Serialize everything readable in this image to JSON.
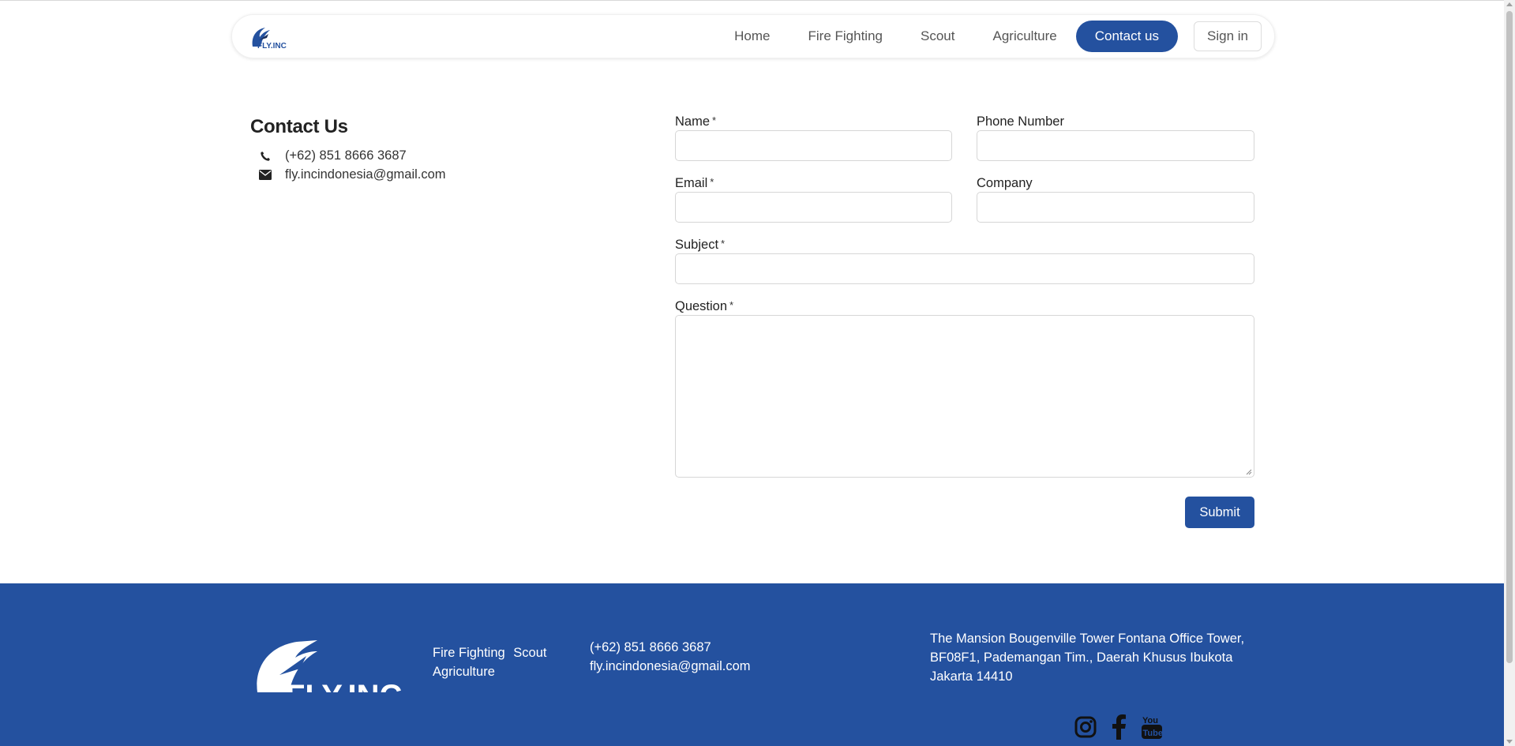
{
  "brand": {
    "logo_text": "FLY.INC",
    "primary_color": "#24519f"
  },
  "nav": {
    "items": [
      {
        "label": "Home"
      },
      {
        "label": "Fire Fighting"
      },
      {
        "label": "Scout"
      },
      {
        "label": "Agriculture"
      }
    ],
    "contact_label": "Contact us",
    "signin_label": "Sign in"
  },
  "contact": {
    "title": "Contact Us",
    "phone": "(+62) 851 8666 3687",
    "email": "fly.incindonesia@gmail.com",
    "phone_icon": "phone-icon",
    "email_icon": "envelope-icon"
  },
  "form": {
    "name_label": "Name",
    "phone_label": "Phone Number",
    "email_label": "Email",
    "company_label": "Company",
    "subject_label": "Subject",
    "question_label": "Question",
    "required_mark": "*",
    "name_value": "",
    "phone_value": "",
    "email_value": "",
    "company_value": "",
    "subject_value": "",
    "question_value": "",
    "submit_label": "Submit"
  },
  "footer": {
    "logo_text": "FLY.INC",
    "links": [
      "Fire Fighting",
      "Scout",
      "Agriculture"
    ],
    "phone": "(+62) 851 8666 3687",
    "email": "fly.incindonesia@gmail.com",
    "address": "The Mansion Bougenville Tower Fontana Office Tower, BF08F1, Pademangan Tim., Daerah Khusus Ibukota Jakarta 14410",
    "social": [
      "instagram-icon",
      "facebook-icon",
      "youtube-icon"
    ]
  }
}
